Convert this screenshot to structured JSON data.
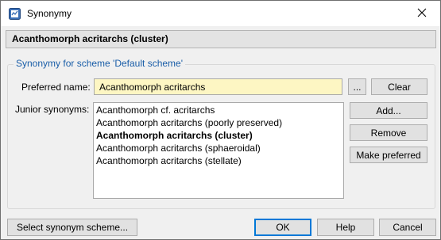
{
  "window": {
    "title": "Synonymy",
    "app_icon": "app-icon",
    "close_icon": "close-icon"
  },
  "header": {
    "name": "Acanthomorph acritarchs (cluster)"
  },
  "group": {
    "title": "Synonymy for scheme 'Default scheme'",
    "preferred_label": "Preferred name:",
    "preferred_value": "Acanthomorph acritarchs",
    "browse_label": "...",
    "clear_label": "Clear",
    "junior_label": "Junior synonyms:",
    "junior_items": [
      {
        "label": "Acanthomorph cf. acritarchs",
        "bold": false
      },
      {
        "label": "Acanthomorph acritarchs (poorly preserved)",
        "bold": false
      },
      {
        "label": "Acanthomorph acritarchs (cluster)",
        "bold": true
      },
      {
        "label": "Acanthomorph acritarchs (sphaeroidal)",
        "bold": false
      },
      {
        "label": "Acanthomorph acritarchs (stellate)",
        "bold": false
      }
    ],
    "add_label": "Add...",
    "remove_label": "Remove",
    "make_preferred_label": "Make preferred"
  },
  "footer": {
    "select_scheme_label": "Select synonym scheme...",
    "ok_label": "OK",
    "help_label": "Help",
    "cancel_label": "Cancel"
  }
}
